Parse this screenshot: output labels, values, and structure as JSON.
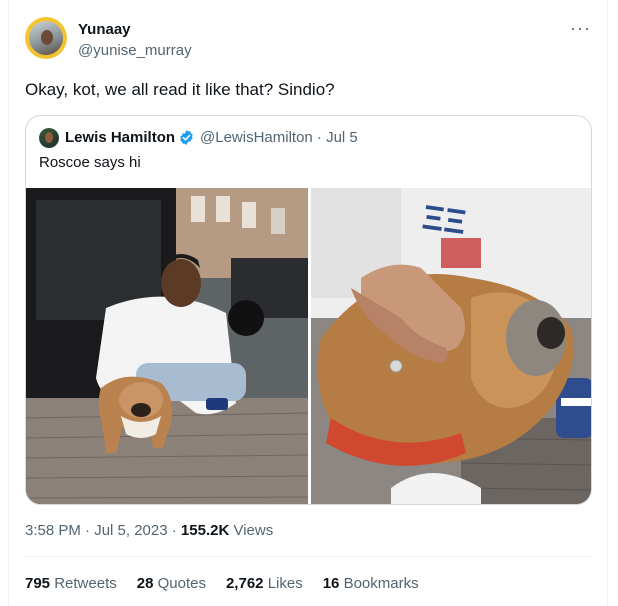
{
  "tweet": {
    "author_name": "Yunaay",
    "author_handle": "@yunise_murray",
    "more_icon": "more-icon",
    "text": "Okay, kot, we all read it like that? Sindio?",
    "timestamp": "3:58 PM · Jul 5, 2023 · ",
    "views_count": "155.2K",
    "views_label": " Views"
  },
  "quote": {
    "author_name": "Lewis Hamilton",
    "verified_icon": "verified-badge-icon",
    "handle_date": "@LewisHamilton · Jul 5",
    "text": "Roscoe says hi"
  },
  "stats": [
    {
      "count": "795",
      "label": "Retweets"
    },
    {
      "count": "28",
      "label": "Quotes"
    },
    {
      "count": "2,762",
      "label": "Likes"
    },
    {
      "count": "16",
      "label": "Bookmarks"
    }
  ],
  "colors": {
    "text": "#0f1419",
    "secondary": "#536471",
    "border": "#cfd9de",
    "verified": "#1d9bf0",
    "avatar_ring": "#f4c430"
  }
}
